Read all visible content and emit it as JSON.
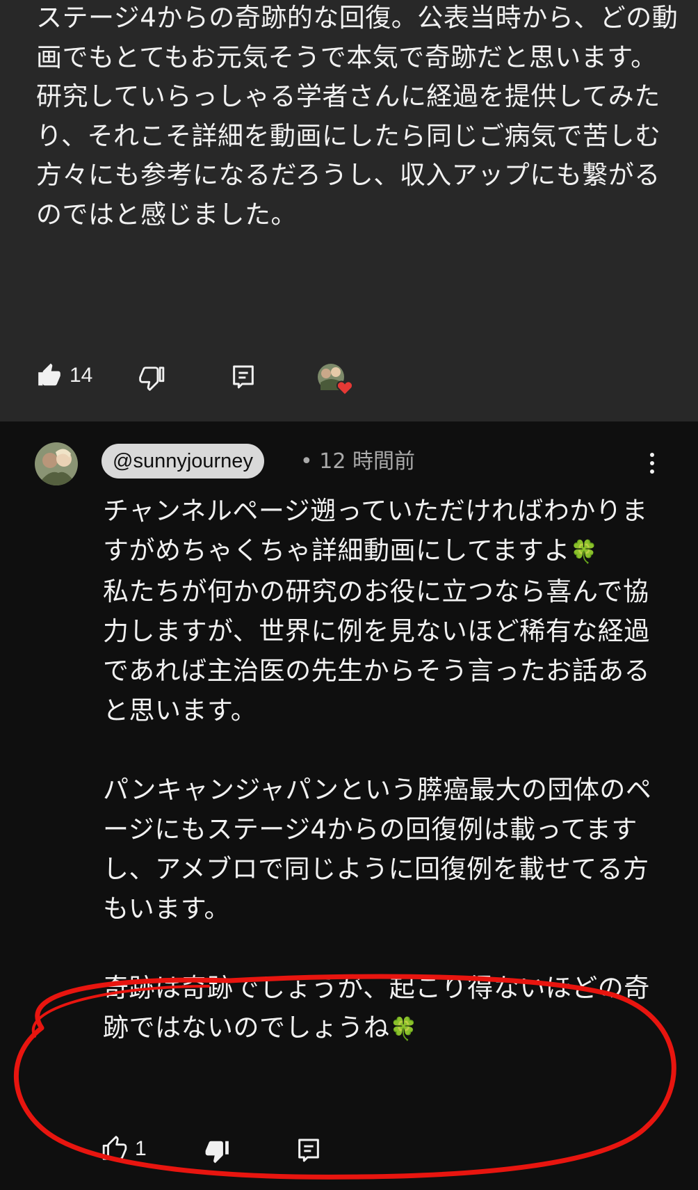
{
  "top_comment": {
    "text": "ステージ4からの奇跡的な回復。公表当時から、どの動画でもとてもお元気そうで本気で奇跡だと思います。\n研究していらっしゃる学者さんに経過を提供してみたり、それこそ詳細を動画にしたら同じご病気で苦しむ方々にも参考になるだろうし、収入アップにも繋がるのではと感じました。",
    "like_count": "14"
  },
  "reply": {
    "handle": "@sunnyjourney",
    "time": "• 12 時間前",
    "paragraph1": "チャンネルページ遡っていただければわかりますがめちゃくちゃ詳細動画にしてますよ",
    "paragraph1_cont": "私たちが何かの研究のお役に立つなら喜んで協力しますが、世界に例を見ないほど稀有な経過であれば主治医の先生からそう言ったお話あると思います。",
    "paragraph2": "パンキャンジャパンという膵癌最大の団体のページにもステージ4からの回復例は載ってますし、アメブロで同じように回復例を載せてる方もいます。",
    "paragraph3": "奇跡は奇跡でしょうが、起こり得ないほどの奇跡ではないのでしょうね",
    "clover": "🍀",
    "like_count": "1"
  },
  "colors": {
    "top_bg": "#282828",
    "page_bg": "#0f0f0f",
    "text": "#f1f1f1",
    "muted": "#aaaaaa",
    "annotation": "#e8150f",
    "heart": "#e53935"
  },
  "icons": [
    "thumb-up-filled-icon",
    "thumb-down-icon",
    "reply-icon",
    "creator-heart-icon",
    "more-vert-icon",
    "thumb-up-icon",
    "thumb-down-filled-icon",
    "clover-emoji"
  ]
}
